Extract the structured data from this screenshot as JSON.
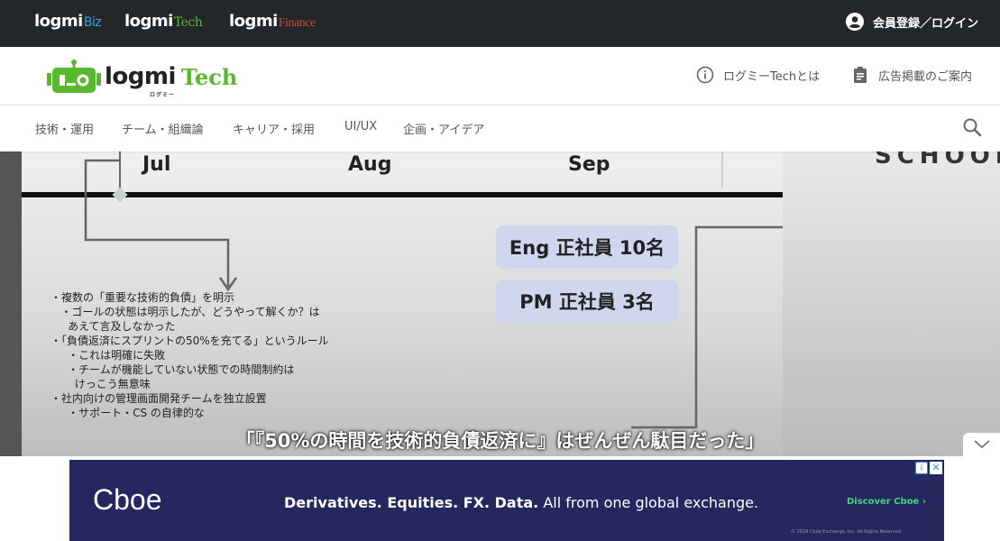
{
  "topbar": {
    "sites": [
      {
        "name": "logmi",
        "sub": "Biz"
      },
      {
        "name": "logmi",
        "sub": "Tech"
      },
      {
        "name": "logmi",
        "sub": "Finance"
      }
    ],
    "login_label": "会員登録／ログイン"
  },
  "header": {
    "logo_word": "logmi",
    "logo_kana": "ログミー",
    "logo_tech": "Tech",
    "about_label": "ログミーTechとは",
    "ad_label": "広告掲載のご案内"
  },
  "nav": {
    "items": [
      "技術・運用",
      "チーム・組織論",
      "キャリア・採用",
      "UI/UX",
      "企画・アイデア"
    ]
  },
  "slide": {
    "months": [
      "Jul",
      "Aug",
      "Sep"
    ],
    "badges": [
      "Eng 正社員 10名",
      "PM 正社員 3名"
    ],
    "notes": [
      "・複数の「重要な技術的負債」を明示",
      "   ・ゴールの状態は明示したが、どうやって解くか？は",
      "     あえて言及しなかった",
      "",
      "・「負債返済にスプリントの50%を充てる」というルール",
      "     ・これは明確に失敗",
      "     ・チームが機能していない状態での時間制約は",
      "       けっこう無意味",
      "",
      "・社内向けの管理画面開発チームを独立設置",
      "     ・サポート・CS の自律的な"
    ],
    "right_text": "SCHOOL",
    "caption": "「『50%の時間を技術的負債返済に』はぜんぜん駄目だった」"
  },
  "ad": {
    "brand": "Cboe",
    "headline_bold": "Derivatives. Equities. FX. Data.",
    "headline_rest": " All from one global exchange.",
    "cta": "Discover Cboe ›",
    "legal": "© 2024 Cboe Exchange, Inc. All Rights Reserved."
  },
  "colors": {
    "topbar_bg": "#23272a",
    "brand_green": "#5ab82e",
    "biz_blue": "#3fa0e6",
    "finance_red": "#d1453b",
    "ad_bg": "#25285e",
    "ad_cta": "#3fd67b"
  }
}
